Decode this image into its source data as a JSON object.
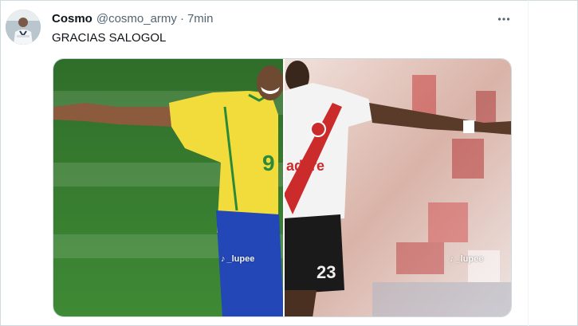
{
  "tweet": {
    "author_name": "Cosmo",
    "handle": "@cosmo_army",
    "separator": "·",
    "time": "7min",
    "text": "GRACIAS SALOGOL"
  },
  "icons": {
    "avatar": "profile-photo",
    "more": "more-horizontal-icon"
  },
  "media": {
    "left_player_number": "9",
    "right_player_number": "23",
    "sponsor_text": "adere",
    "watermark_left": "_lupee",
    "watermark_right": "_lupee",
    "watermark_glyph": "♪"
  },
  "colors": {
    "text_primary": "#0f1419",
    "text_secondary": "#536471",
    "border": "#cfd9de"
  }
}
